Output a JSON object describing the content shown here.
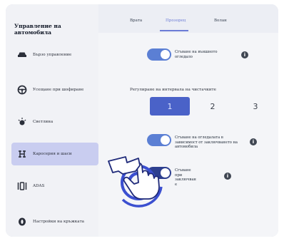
{
  "sidebar": {
    "title": "Управление на автомобила",
    "items": [
      {
        "label": "Бързо управление",
        "icon": "car-icon"
      },
      {
        "label": "Усещане при шофиране",
        "icon": "steering-wheel-icon"
      },
      {
        "label": "Светлина",
        "icon": "light-icon"
      },
      {
        "label": "Каросерия и шаси",
        "icon": "car-body-icon",
        "active": true
      },
      {
        "label": "ADAS",
        "icon": "adas-icon"
      },
      {
        "label": "Настройки на кръжката",
        "icon": "tire-icon"
      }
    ]
  },
  "tabs": [
    {
      "label": "Врата"
    },
    {
      "label": "Прозорец",
      "active": true
    },
    {
      "label": "Волан"
    }
  ],
  "options": {
    "fold_mirrors": "Сгъване на външното огледало",
    "wiper_label": "Регулиране на интервала на чистачките",
    "wiper_levels": [
      "1",
      "2",
      "3"
    ],
    "wiper_selected": "1",
    "lock_fold": "Сгъване на огледалата в зависимост от заключването на автомобила",
    "fold_on_lock": "Сгъване при заключван е"
  },
  "colors": {
    "accent": "#5b7fd4",
    "segment_active": "#4a62c8",
    "sidebar_active": "#c9cdf0",
    "gesture": "#3b4fd0"
  },
  "gesture_icon": "tap-hand-icon"
}
